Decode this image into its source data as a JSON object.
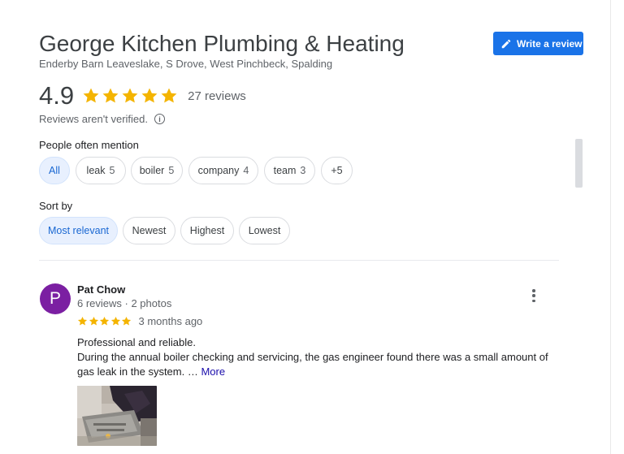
{
  "business": {
    "name": "George Kitchen Plumbing & Heating",
    "address": "Enderby Barn Leaveslake, S Drove, West Pinchbeck, Spalding"
  },
  "write_review": {
    "label": "Write a review",
    "icon": "pencil-icon",
    "color": "#1a73e8"
  },
  "rating": {
    "score": "4.9",
    "stars": 5,
    "star_color": "#f4b400",
    "review_count": "27 reviews",
    "verification_note": "Reviews aren't verified.",
    "info_icon": "info-icon"
  },
  "mentions": {
    "label": "People often mention",
    "chips": [
      {
        "label": "All",
        "count": "",
        "active": true
      },
      {
        "label": "leak",
        "count": "5"
      },
      {
        "label": "boiler",
        "count": "5"
      },
      {
        "label": "company",
        "count": "4"
      },
      {
        "label": "team",
        "count": "3"
      },
      {
        "label": "+5",
        "count": ""
      }
    ]
  },
  "sort": {
    "label": "Sort by",
    "options": [
      {
        "label": "Most relevant",
        "active": true
      },
      {
        "label": "Newest"
      },
      {
        "label": "Highest"
      },
      {
        "label": "Lowest"
      }
    ]
  },
  "review": {
    "avatar_letter": "P",
    "avatar_color": "#7b1fa2",
    "reviewer_name": "Pat Chow",
    "reviewer_meta": "6 reviews · 2 photos",
    "stars": 5,
    "time": "3 months ago",
    "line1": "Professional and reliable.",
    "line2": "During the annual boiler checking and servicing, the gas engineer found there was a small amount of gas leak in the system. …",
    "more": "More",
    "menu_icon": "more-vert-icon"
  }
}
